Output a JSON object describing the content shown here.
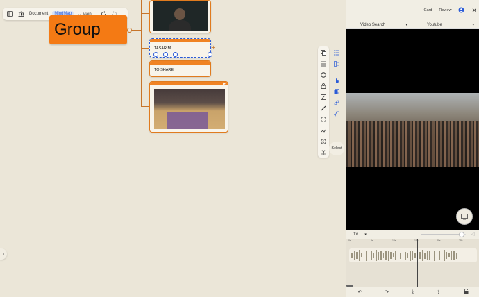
{
  "toolbar": {
    "document_label": "Document",
    "mindmap_label": "MindMap",
    "main_label": "Main"
  },
  "mindmap": {
    "group_label": "Group",
    "tasarim_label": "TASARIM",
    "toshare_label": "TO SHARE"
  },
  "palette": {
    "select_label": "Select"
  },
  "right_panel": {
    "card_label": "Card",
    "review_label": "Review",
    "tabs": [
      {
        "label": "Video Search"
      },
      {
        "label": "Youtube"
      }
    ],
    "speed_label": "1x",
    "ruler_marks": [
      "0s",
      "5s",
      "10s",
      "15s",
      "20s",
      "25s"
    ]
  },
  "colors": {
    "accent": "#f47a14",
    "selection": "#2a5bd7",
    "background": "#ebe6d8"
  }
}
